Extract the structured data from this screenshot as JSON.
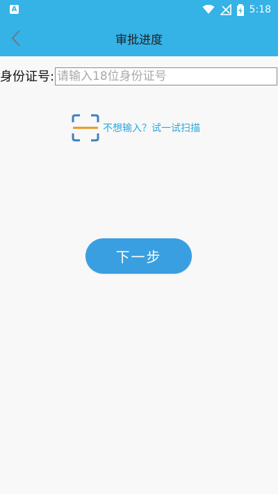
{
  "status_bar": {
    "notification_icon": "A",
    "time": "5:18",
    "icons": [
      "wifi-icon",
      "no-signal-icon",
      "battery-charging-icon"
    ]
  },
  "header": {
    "title": "审批进度",
    "back_icon": "chevron-left-icon"
  },
  "form": {
    "id_label": "身份证号:",
    "id_placeholder": "请输入18位身份证号",
    "id_value": ""
  },
  "scan": {
    "icon": "scan-frame-icon",
    "text": "不想输入？试一试扫描"
  },
  "actions": {
    "next_label": "下一步"
  },
  "colors": {
    "primary": "#35b2e6",
    "button": "#3a9fe0",
    "link": "#2aa9e0",
    "scan_frame": "#3f7fc0",
    "scan_line": "#e39a1e",
    "background": "#f8f8f8"
  }
}
